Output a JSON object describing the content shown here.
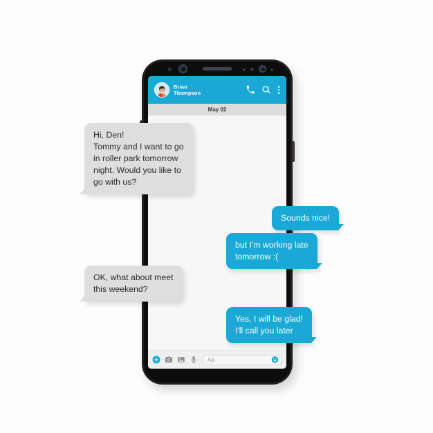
{
  "app": {
    "header": {
      "contact_first_name": "Brian",
      "contact_last_name": "Thompson",
      "avatar_icon": "user-avatar",
      "call_icon": "phone-handset-icon",
      "search_icon": "magnifier-icon",
      "menu_icon": "vertical-dots-icon",
      "background_color": "#1aa9d6"
    },
    "date_divider": {
      "label": "May 02"
    },
    "messages": [
      {
        "id": "bubble-1",
        "side": "left",
        "lines": [
          "Hi, Den!",
          "Tommy and I want to go",
          "in roller park tomorrow",
          "night. Would you like to",
          "go with us?"
        ]
      },
      {
        "id": "bubble-2",
        "side": "right",
        "lines": [
          "Sounds nice!"
        ]
      },
      {
        "id": "bubble-3",
        "side": "right",
        "lines": [
          "but I'm working late",
          "tomorrow :("
        ]
      },
      {
        "id": "bubble-4",
        "side": "left",
        "lines": [
          "OK, what about meet",
          "this weekend?"
        ]
      },
      {
        "id": "bubble-5",
        "side": "right",
        "lines": [
          "Yes, I will be glad!",
          "I'll call you later"
        ]
      }
    ],
    "input_bar": {
      "add_icon": "plus-circle-icon",
      "camera_icon": "camera-icon",
      "gallery_icon": "image-icon",
      "mic_icon": "microphone-icon",
      "text_placeholder": "Aa",
      "emoji_icon": "smiley-icon"
    },
    "colors": {
      "accent": "#1aa9d6",
      "incoming_bubble": "#dedede",
      "incoming_text": "#2b2b2b",
      "outgoing_text": "#ffffff",
      "date_bar": "#dddddd",
      "screen_background": "#f7f7f7",
      "phone_frame": "#231f20"
    }
  },
  "device": {
    "hardware": {
      "front_camera": "camera-lens",
      "earpiece_speaker": "speaker-grille",
      "proximity_sensor": "sensor-dot",
      "volume_button": "volume-button",
      "power_button": "power-button"
    }
  }
}
